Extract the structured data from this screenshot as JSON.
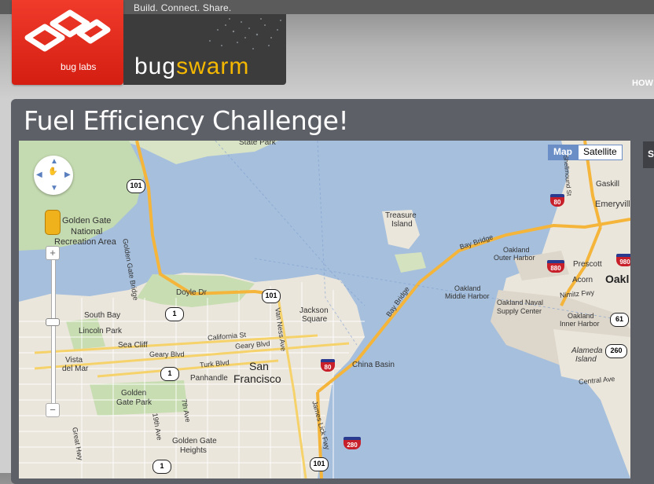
{
  "header": {
    "tagline": "Build. Connect. Share.",
    "logo_label": "bug labs",
    "product_name_part1": "bug",
    "product_name_part2": "swarm",
    "nav_partial": "HOW"
  },
  "page": {
    "title": "Fuel Efficiency Challenge!",
    "side_tab_label": "S"
  },
  "map": {
    "type_buttons": [
      "Map",
      "Satellite"
    ],
    "active_type": "Map",
    "zoom_in": "+",
    "zoom_out": "−",
    "labels": {
      "state_park": "State Park",
      "golden_gate_nra_1": "Golden Gate",
      "golden_gate_nra_2": "National",
      "golden_gate_nra_3": "Recreation Area",
      "golden_gate_bridge": "Golden Gate Bridge",
      "doyle_dr": "Doyle Dr",
      "treasure_island_1": "Treasure",
      "treasure_island_2": "Island",
      "bay_bridge_1": "Bay Bridge",
      "bay_bridge_2": "Bay Bridge",
      "oakland_outer_harbor_1": "Oakland",
      "oakland_outer_harbor_2": "Outer Harbor",
      "oakland_middle_harbor_1": "Oakland",
      "oakland_middle_harbor_2": "Middle Harbor",
      "oakland_naval_1": "Oakland Naval",
      "oakland_naval_2": "Supply Center",
      "oakland_inner_harbor_1": "Oakland",
      "oakland_inner_harbor_2": "Inner Harbor",
      "gaskill": "Gaskill",
      "emeryville": "Emeryville",
      "prescott": "Prescott",
      "acorn": "Acorn",
      "oakland_partial": "Oakl",
      "nimitz_fwy": "Nimitz Fwy",
      "alameda_1": "Alameda",
      "alameda_2": "Island",
      "central_ave": "Central Ave",
      "shellmound": "Shellmound St",
      "south_bay": "South Bay",
      "lincoln_park": "Lincoln Park",
      "sea_cliff": "Sea Cliff",
      "vista_del_mar_1": "Vista",
      "vista_del_mar_2": "del Mar",
      "geary_blvd_1": "Geary Blvd",
      "geary_blvd_2": "Geary Blvd",
      "california_st": "California St",
      "turk_blvd": "Turk Blvd",
      "panhandle": "Panhandle",
      "golden_gate_park_1": "Golden",
      "golden_gate_park_2": "Gate Park",
      "great_hwy": "Great Hwy",
      "ave_19th": "19th Ave",
      "ave_7th": "7th Ave",
      "golden_gate_heights_1": "Golden Gate",
      "golden_gate_heights_2": "Heights",
      "jackson_square_1": "Jackson",
      "jackson_square_2": "Square",
      "van_ness_ave": "Van Ness Ave",
      "san_francisco_1": "San",
      "san_francisco_2": "Francisco",
      "china_basin": "China Basin",
      "james_lick_fwy": "James Lick Fwy"
    },
    "shields": {
      "us101_a": "101",
      "us101_b": "101",
      "us101_c": "101",
      "ca1_a": "1",
      "ca1_b": "1",
      "ca1_c": "1",
      "i80_a": "80",
      "i80_b": "80",
      "i880": "880",
      "i980": "980",
      "i280": "280",
      "ca61": "61",
      "ca260": "260"
    }
  }
}
